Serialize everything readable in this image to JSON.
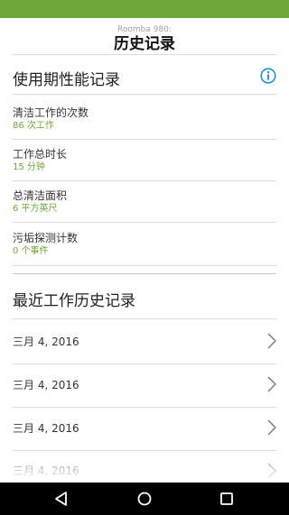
{
  "header": {
    "subtitle": "Roomba 980:",
    "title": "历史记录"
  },
  "stats_section": {
    "title": "使用期性能记录",
    "info_icon": "info-circle-icon",
    "items": [
      {
        "label": "清洁工作的次数",
        "value": "86 次工作"
      },
      {
        "label": "工作总时长",
        "value": "15 分钟"
      },
      {
        "label": "总清洁面积",
        "value": "6 平方英尺"
      },
      {
        "label": "污垢探测计数",
        "value": "0 个事件"
      }
    ]
  },
  "history_section": {
    "title": "最近工作历史记录",
    "items": [
      {
        "date": "三月 4, 2016"
      },
      {
        "date": "三月 4, 2016"
      },
      {
        "date": "三月 4, 2016"
      }
    ]
  },
  "nav": {
    "back_icon": "back-triangle-icon",
    "home_icon": "home-circle-icon",
    "recents_icon": "recents-square-icon"
  },
  "colors": {
    "accent": "#6fa83a",
    "info_blue": "#2a8fc9",
    "nav_bar": "#000000"
  }
}
